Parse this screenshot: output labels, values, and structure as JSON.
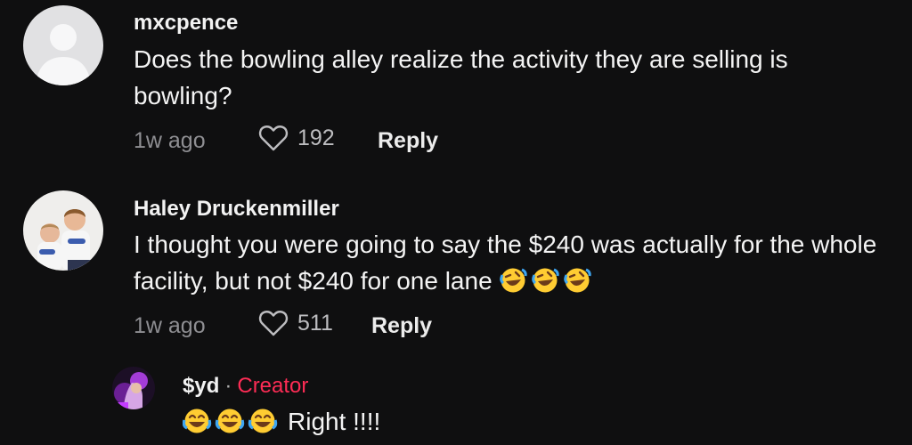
{
  "comments": [
    {
      "username": "mxcpence",
      "text": "Does the bowling alley realize the activity they are selling is bowling?",
      "time": "1w ago",
      "likes": "192",
      "reply_label": "Reply"
    },
    {
      "username": "Haley Druckenmiller",
      "text": "I thought you were going to say the $240 was actually for the whole facility, but not $240 for one lane",
      "emoji_suffix": "rolling-on-floor-laughing x3",
      "time": "1w ago",
      "likes": "511",
      "reply_label": "Reply"
    }
  ],
  "reply": {
    "username": "$yd",
    "separator": "·",
    "badge": "Creator",
    "text": "Right !!!!",
    "emoji_prefix": "tears-of-joy x3"
  },
  "colors": {
    "background": "#0f0f10",
    "creator_badge": "#fe2c55",
    "muted": "#8e8e92"
  }
}
